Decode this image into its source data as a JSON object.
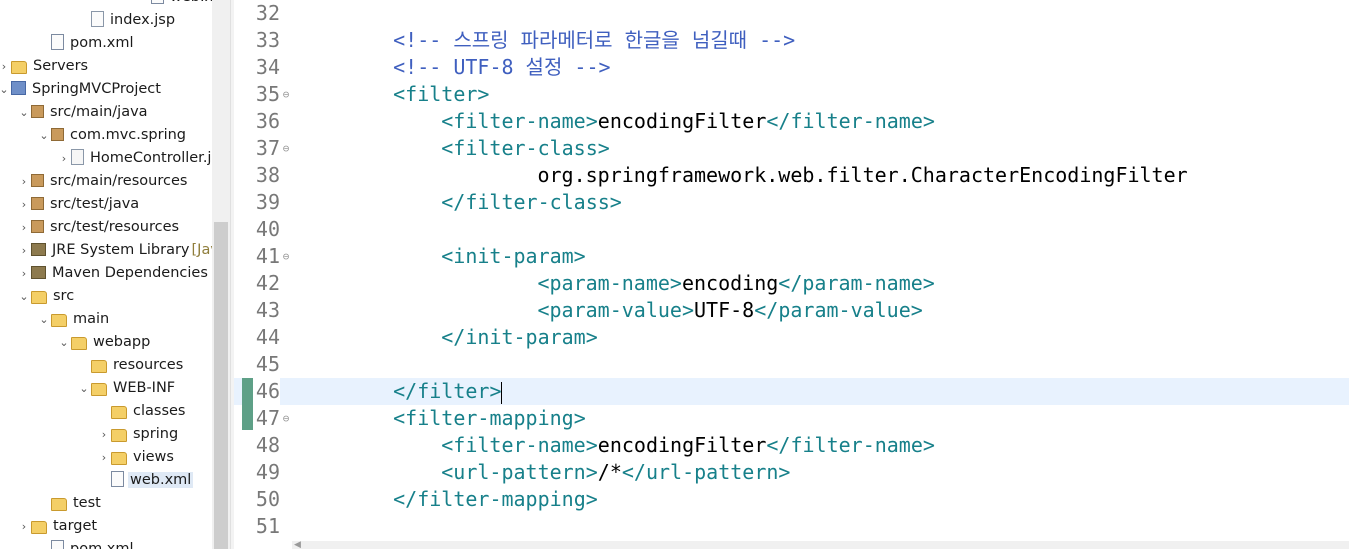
{
  "explorer": {
    "items": [
      {
        "label": "web.xml",
        "extra": "",
        "icon": "xml-file-icon",
        "twisty": ""
      },
      {
        "label": "index.jsp",
        "extra": "",
        "icon": "jsp-file-icon",
        "twisty": ""
      },
      {
        "label": "pom.xml",
        "extra": "",
        "icon": "maven-pom-icon",
        "twisty": ""
      },
      {
        "label": "Servers",
        "extra": "",
        "icon": "servers-folder-icon",
        "twisty": ">"
      },
      {
        "label": "SpringMVCProject",
        "extra": "",
        "icon": "spring-project-icon",
        "twisty": "v"
      },
      {
        "label": "src/main/java",
        "extra": "",
        "icon": "source-folder-icon",
        "twisty": "v"
      },
      {
        "label": "com.mvc.spring",
        "extra": "",
        "icon": "package-icon",
        "twisty": "v"
      },
      {
        "label": "HomeController.j",
        "extra": "",
        "icon": "java-file-icon",
        "twisty": ">"
      },
      {
        "label": "src/main/resources",
        "extra": "",
        "icon": "source-folder-icon",
        "twisty": ">"
      },
      {
        "label": "src/test/java",
        "extra": "",
        "icon": "source-folder-icon",
        "twisty": ">"
      },
      {
        "label": "src/test/resources",
        "extra": "",
        "icon": "source-folder-icon",
        "twisty": ">"
      },
      {
        "label": "JRE System Library",
        "extra": "[Java",
        "icon": "library-icon",
        "twisty": ">"
      },
      {
        "label": "Maven Dependencies",
        "extra": "",
        "icon": "library-icon",
        "twisty": ">"
      },
      {
        "label": "src",
        "extra": "",
        "icon": "folder-icon",
        "twisty": "v"
      },
      {
        "label": "main",
        "extra": "",
        "icon": "folder-icon",
        "twisty": "v"
      },
      {
        "label": "webapp",
        "extra": "",
        "icon": "folder-icon",
        "twisty": "v"
      },
      {
        "label": "resources",
        "extra": "",
        "icon": "folder-icon",
        "twisty": ""
      },
      {
        "label": "WEB-INF",
        "extra": "",
        "icon": "folder-icon",
        "twisty": "v"
      },
      {
        "label": "classes",
        "extra": "",
        "icon": "folder-icon",
        "twisty": ""
      },
      {
        "label": "spring",
        "extra": "",
        "icon": "folder-icon",
        "twisty": ">"
      },
      {
        "label": "views",
        "extra": "",
        "icon": "folder-icon",
        "twisty": ">"
      },
      {
        "label": "web.xml",
        "extra": "",
        "icon": "xml-file-icon",
        "twisty": ""
      },
      {
        "label": "test",
        "extra": "",
        "icon": "folder-icon",
        "twisty": ""
      },
      {
        "label": "target",
        "extra": "",
        "icon": "folder-icon",
        "twisty": ">"
      },
      {
        "label": "pom.xml",
        "extra": "",
        "icon": "maven-pom-icon",
        "twisty": ""
      }
    ],
    "selected_label": "web.xml"
  },
  "editor": {
    "current_line": "46",
    "lines": [
      {
        "num": "32",
        "fold": "",
        "parts": []
      },
      {
        "num": "33",
        "fold": "",
        "parts": [
          {
            "t": "comment",
            "v": "<!-- 스프링 파라메터로 한글을 넘길때 -->"
          }
        ]
      },
      {
        "num": "34",
        "fold": "",
        "parts": [
          {
            "t": "comment",
            "v": "<!-- UTF-8 설정 -->"
          }
        ]
      },
      {
        "num": "35",
        "fold": "⊖",
        "parts": [
          {
            "t": "tag",
            "v": "<filter>"
          }
        ]
      },
      {
        "num": "36",
        "fold": "",
        "parts": [
          {
            "t": "tag",
            "v": "<filter-name>"
          },
          {
            "t": "text",
            "v": "encodingFilter"
          },
          {
            "t": "tag",
            "v": "</filter-name>"
          }
        ]
      },
      {
        "num": "37",
        "fold": "⊖",
        "parts": [
          {
            "t": "tag",
            "v": "<filter-class>"
          }
        ]
      },
      {
        "num": "38",
        "fold": "",
        "parts": [
          {
            "t": "text",
            "v": "org.springframework.web.filter.CharacterEncodingFilter"
          }
        ]
      },
      {
        "num": "39",
        "fold": "",
        "parts": [
          {
            "t": "tag",
            "v": "</filter-class>"
          }
        ]
      },
      {
        "num": "40",
        "fold": "",
        "parts": []
      },
      {
        "num": "41",
        "fold": "⊖",
        "parts": [
          {
            "t": "tag",
            "v": "<init-param>"
          }
        ]
      },
      {
        "num": "42",
        "fold": "",
        "parts": [
          {
            "t": "tag",
            "v": "<param-name>"
          },
          {
            "t": "text",
            "v": "encoding"
          },
          {
            "t": "tag",
            "v": "</param-name>"
          }
        ]
      },
      {
        "num": "43",
        "fold": "",
        "parts": [
          {
            "t": "tag",
            "v": "<param-value>"
          },
          {
            "t": "text",
            "v": "UTF-8"
          },
          {
            "t": "tag",
            "v": "</param-value>"
          }
        ]
      },
      {
        "num": "44",
        "fold": "",
        "parts": [
          {
            "t": "tag",
            "v": "</init-param>"
          }
        ]
      },
      {
        "num": "45",
        "fold": "",
        "parts": []
      },
      {
        "num": "46",
        "fold": "",
        "parts": [
          {
            "t": "tag",
            "v": "</filter>"
          }
        ]
      },
      {
        "num": "47",
        "fold": "⊖",
        "parts": [
          {
            "t": "tag",
            "v": "<filter-mapping>"
          }
        ]
      },
      {
        "num": "48",
        "fold": "",
        "parts": [
          {
            "t": "tag",
            "v": "<filter-name>"
          },
          {
            "t": "text",
            "v": "encodingFilter"
          },
          {
            "t": "tag",
            "v": "</filter-name>"
          }
        ]
      },
      {
        "num": "49",
        "fold": "",
        "parts": [
          {
            "t": "tag",
            "v": "<url-pattern>"
          },
          {
            "t": "text",
            "v": "/*"
          },
          {
            "t": "tag",
            "v": "</url-pattern>"
          }
        ]
      },
      {
        "num": "50",
        "fold": "",
        "parts": [
          {
            "t": "tag",
            "v": "</filter-mapping>"
          }
        ]
      },
      {
        "num": "51",
        "fold": "",
        "parts": []
      }
    ]
  },
  "colors": {
    "comment": "#3f5fbf",
    "tag": "#17808a",
    "text": "#000000",
    "current_line_bg": "#e8f2fe",
    "change_marker": "#5ea087"
  }
}
